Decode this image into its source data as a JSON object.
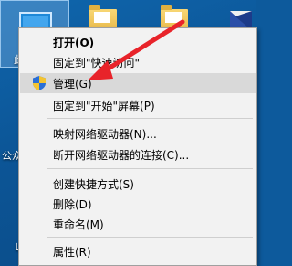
{
  "desktop": {
    "partial_labels": [
      "此",
      "公众",
      "以"
    ]
  },
  "menu": {
    "items": [
      {
        "label": "打开(O)",
        "bold": true
      },
      {
        "label": "固定到\"快速访问\""
      },
      {
        "label": "管理(G)",
        "icon": "uac-shield-icon",
        "highlighted": true
      },
      {
        "label": "固定到\"开始\"屏幕(P)"
      },
      {
        "label": "映射网络驱动器(N)..."
      },
      {
        "label": "断开网络驱动器的连接(C)..."
      },
      {
        "label": "创建快捷方式(S)"
      },
      {
        "label": "删除(D)"
      },
      {
        "label": "重命名(M)"
      },
      {
        "label": "属性(R)"
      }
    ]
  },
  "colors": {
    "desktop_bg": "#0c5596",
    "menu_bg": "#f2f2f2",
    "highlight": "#d9d9d9",
    "arrow": "#e8232a"
  },
  "icons": [
    "this-pc-icon",
    "folder-icon",
    "folder-icon",
    "network-icon",
    "uac-shield-icon",
    "red-arrow-annotation"
  ]
}
